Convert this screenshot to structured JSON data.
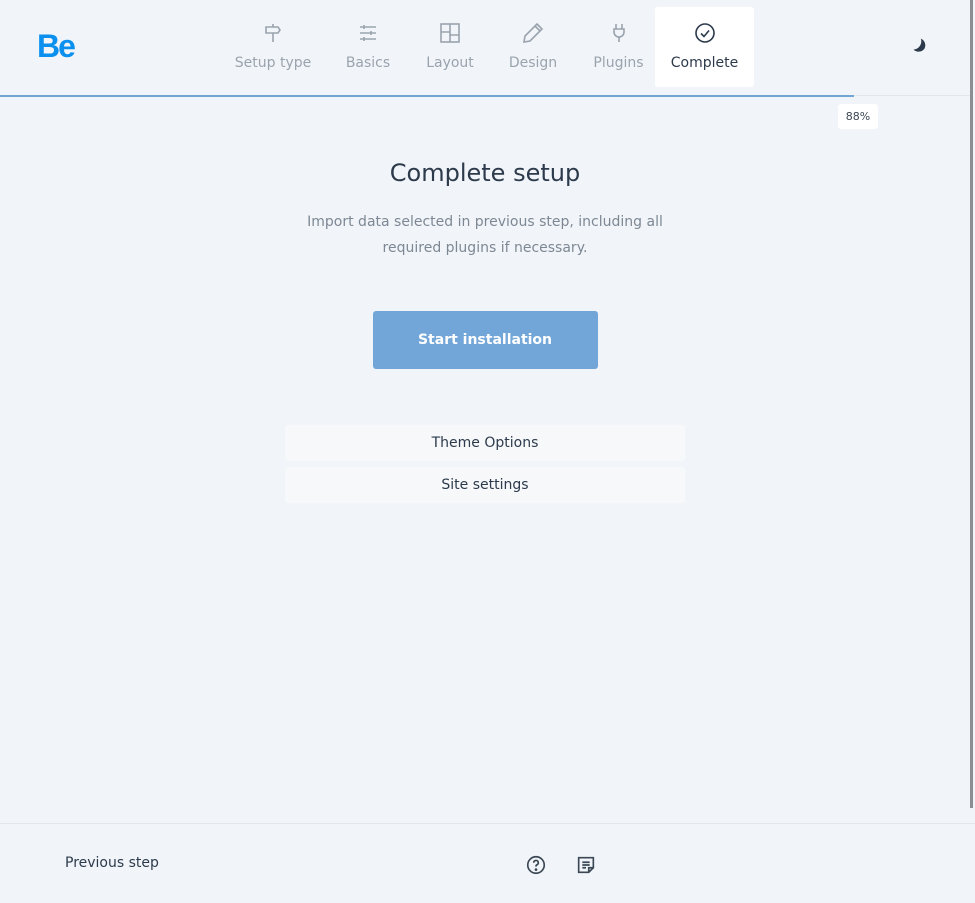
{
  "header": {
    "logo": "Be",
    "steps": [
      {
        "label": "Setup type",
        "icon": "signpost-icon",
        "active": false
      },
      {
        "label": "Basics",
        "icon": "sliders-icon",
        "active": false
      },
      {
        "label": "Layout",
        "icon": "layout-grid-icon",
        "active": false
      },
      {
        "label": "Design",
        "icon": "pencil-icon",
        "active": false
      },
      {
        "label": "Plugins",
        "icon": "plug-icon",
        "active": false
      },
      {
        "label": "Complete",
        "icon": "check-circle-icon",
        "active": true
      }
    ],
    "progress_percent": 88,
    "progress_label": "88%",
    "theme_toggle_icon": "moon-icon"
  },
  "main": {
    "title": "Complete setup",
    "description": "Import data selected in previous step, including all required plugins if necessary.",
    "install_button": "Start installation",
    "options": [
      {
        "label": "Theme Options"
      },
      {
        "label": "Site settings"
      }
    ]
  },
  "footer": {
    "previous_label": "Previous step",
    "help_icon": "help-circle-icon",
    "notes_icon": "notes-icon"
  },
  "colors": {
    "brand": "#0b90f0",
    "accent": "#72a6d8",
    "background": "#f1f5f9",
    "text": "#2c3a4b"
  }
}
